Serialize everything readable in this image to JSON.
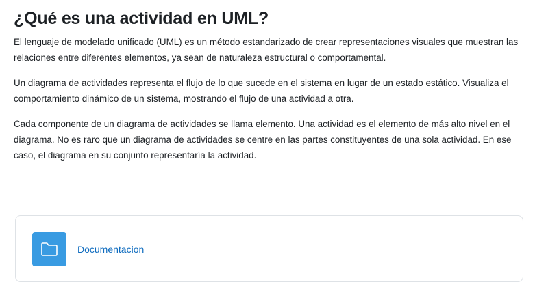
{
  "section": {
    "title": "¿Qué es una actividad en UML?",
    "paragraphs": [
      "El lenguaje de modelado unificado (UML) es un método estandarizado de crear representaciones visuales que muestran las relaciones entre diferentes elementos, ya sean de naturaleza estructural o comportamental.",
      "Un diagrama de actividades representa el flujo de lo que sucede en el sistema en lugar de un estado estático. Visualiza el comportamiento dinámico de un sistema, mostrando el flujo de una actividad a otra.",
      "Cada componente de un diagrama de actividades se llama elemento. Una actividad es el elemento de más alto nivel en el diagrama. No es raro que un diagrama de actividades se centre en las partes constituyentes de una sola actividad. En ese caso, el diagrama en su conjunto representaría la actividad."
    ]
  },
  "resource": {
    "label": "Documentacion",
    "icon": "folder-icon",
    "icon_bg_color": "#399be2",
    "link_color": "#0f6cbf"
  }
}
